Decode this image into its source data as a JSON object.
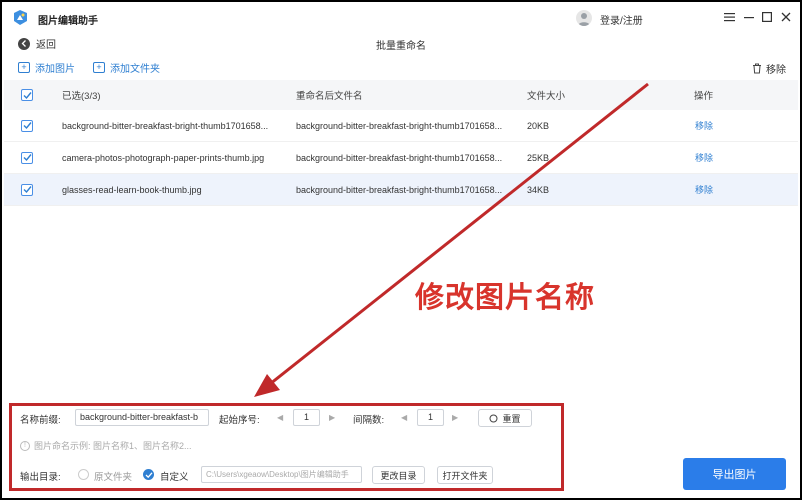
{
  "app": {
    "title": "图片编辑助手",
    "login": "登录/注册"
  },
  "nav": {
    "back": "返回",
    "page_title": "批量重命名"
  },
  "toolbar": {
    "add_image": "添加图片",
    "add_folder": "添加文件夹",
    "remove": "移除"
  },
  "table": {
    "headers": {
      "selected": "已选(3/3)",
      "renamed": "重命名后文件名",
      "size": "文件大小",
      "action": "操作"
    },
    "rows": [
      {
        "original": "background-bitter-breakfast-bright-thumb1701658...",
        "renamed": "background-bitter-breakfast-bright-thumb1701658...",
        "size": "20KB",
        "action": "移除"
      },
      {
        "original": "camera-photos-photograph-paper-prints-thumb.jpg",
        "renamed": "background-bitter-breakfast-bright-thumb1701658...",
        "size": "25KB",
        "action": "移除"
      },
      {
        "original": "glasses-read-learn-book-thumb.jpg",
        "renamed": "background-bitter-breakfast-bright-thumb1701658...",
        "size": "34KB",
        "action": "移除"
      }
    ]
  },
  "settings": {
    "prefix_label": "名称前缀:",
    "prefix_value": "background-bitter-breakfast-b",
    "start_label": "起始序号:",
    "start_value": "1",
    "interval_label": "间隔数:",
    "interval_value": "1",
    "reset": "重置",
    "hint": "图片命名示例: 图片名称1、图片名称2...",
    "output_label": "输出目录:",
    "option_original": "原文件夹",
    "option_custom": "自定义",
    "path": "C:\\Users\\xgeaow\\Desktop\\图片编辑助手",
    "change_dir": "更改目录",
    "open_folder": "打开文件夹"
  },
  "export": "导出图片",
  "annotation": "修改图片名称",
  "colors": {
    "accent": "#2b7de9",
    "annotation": "#d8342c",
    "frame": "#c0292a"
  }
}
